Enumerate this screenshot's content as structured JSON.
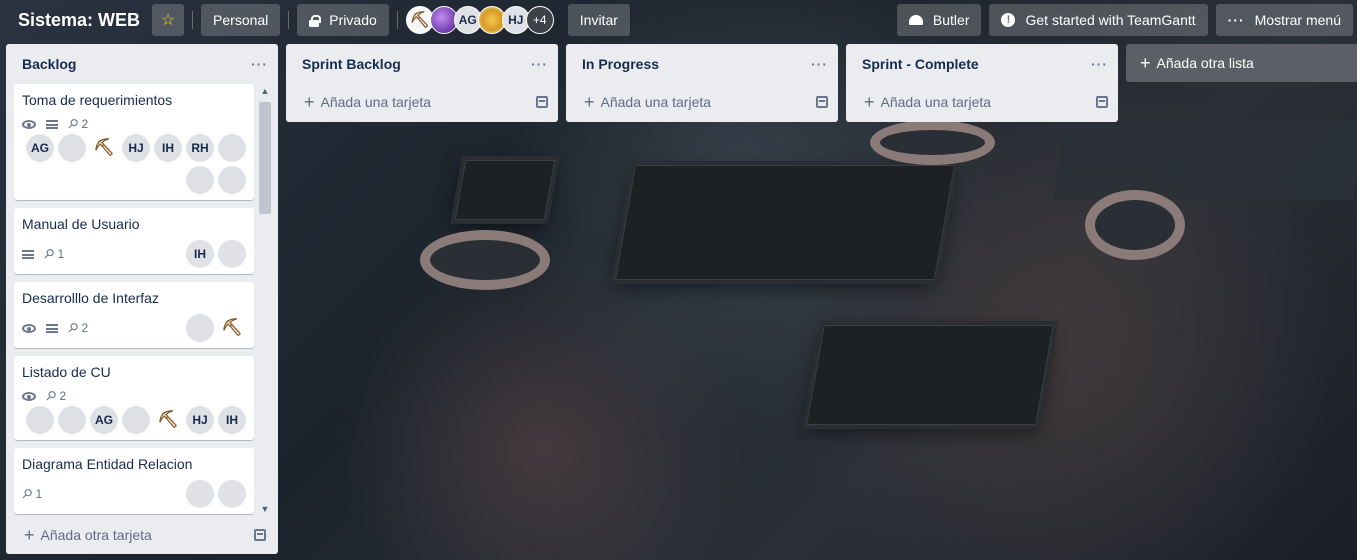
{
  "header": {
    "board_title": "Sistema: WEB",
    "visibility_team": "Personal",
    "visibility_privacy": "Privado",
    "members": [
      {
        "type": "image",
        "style": "pick",
        "icon": "pickaxe"
      },
      {
        "type": "image",
        "style": "purple"
      },
      {
        "type": "initials",
        "initials": "AG"
      },
      {
        "type": "image",
        "style": "blonde"
      },
      {
        "type": "initials",
        "initials": "HJ"
      }
    ],
    "members_more": "+4",
    "invite_label": "Invitar",
    "butler_label": "Butler",
    "teamgantt_label": "Get started with TeamGantt",
    "show_menu_label": "Mostrar menú"
  },
  "lists": {
    "backlog": {
      "title": "Backlog",
      "footer_add": "Añada otra tarjeta",
      "cards": [
        {
          "title": "Toma de requerimientos",
          "has_watch": true,
          "has_description": true,
          "attachments": "2",
          "members": [
            "AG",
            "img-blonde",
            "img-pick",
            "HJ",
            "IH",
            "RH",
            "img-brown",
            "img-purple",
            "img-dark"
          ]
        },
        {
          "title": "Manual de Usuario",
          "has_watch": false,
          "has_description": true,
          "attachments": "1",
          "members": [
            "IH",
            "img-brown"
          ]
        },
        {
          "title": "Desarrolllo de Interfaz",
          "has_watch": true,
          "has_description": true,
          "attachments": "2",
          "members": [
            "img-blonde",
            "img-pick"
          ]
        },
        {
          "title": "Listado de CU",
          "has_watch": true,
          "has_description": false,
          "attachments": "2",
          "members": [
            "img-purple",
            "img-dark",
            "AG",
            "img-blonde",
            "img-pick",
            "HJ",
            "IH"
          ]
        },
        {
          "title": "Diagrama Entidad Relacion",
          "has_watch": false,
          "has_description": false,
          "attachments": "1",
          "members": [
            "img-dark",
            "img-brown"
          ]
        }
      ]
    },
    "sprint_backlog": {
      "title": "Sprint Backlog",
      "add_card": "Añada una tarjeta"
    },
    "in_progress": {
      "title": "In Progress",
      "add_card": "Añada una tarjeta"
    },
    "sprint_complete": {
      "title": "Sprint - Complete",
      "add_card": "Añada una tarjeta"
    }
  },
  "add_list_label": "Añada otra lista",
  "colors": {
    "list_bg": "#ebecf0",
    "card_bg": "#ffffff",
    "text": "#172b4d",
    "muted": "#5e6c84",
    "star": "#f2d600"
  }
}
